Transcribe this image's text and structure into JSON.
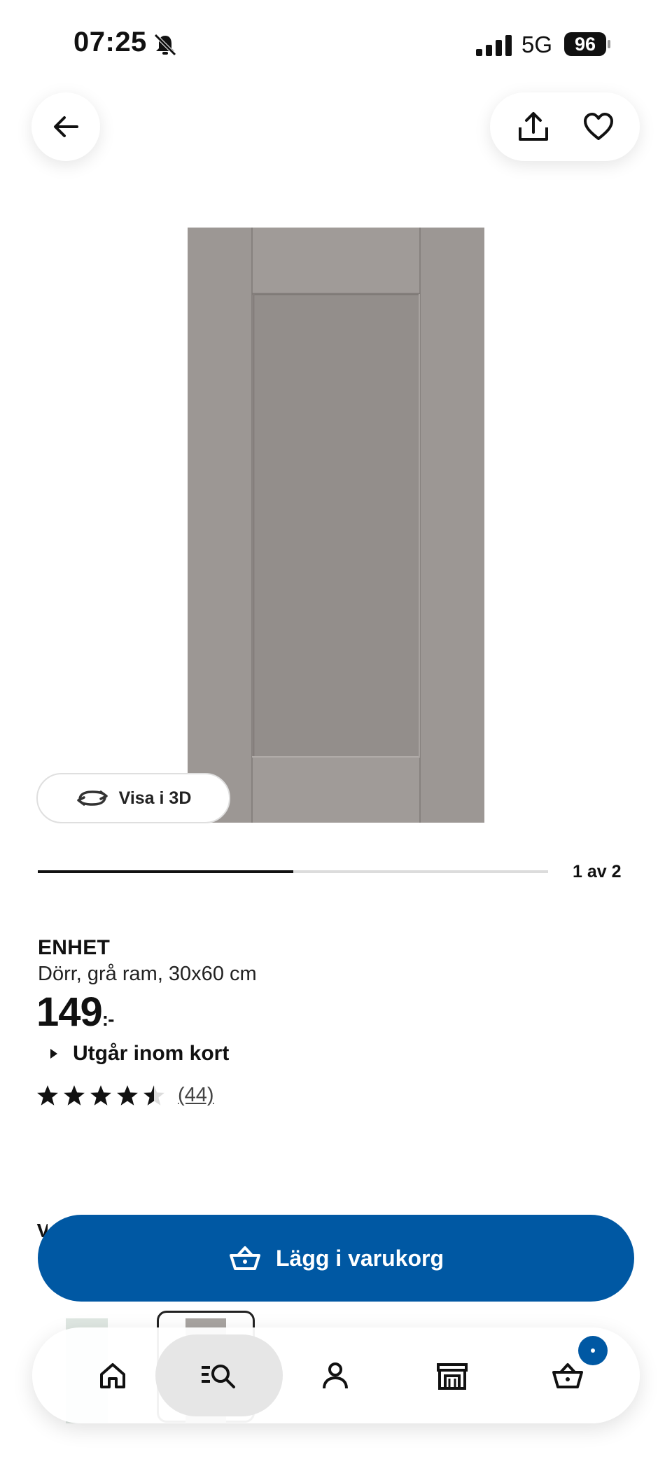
{
  "status_bar": {
    "time": "07:25",
    "network": "5G",
    "battery": "96"
  },
  "gallery": {
    "visa_3d_label": "Visa i 3D",
    "position_text": "1 av 2",
    "progress_fraction": 0.5
  },
  "product": {
    "brand": "ENHET",
    "description": "Dörr, grå ram, 30x60 cm",
    "price": "149",
    "price_suffix": ":-",
    "availability": "Utgår inom kort",
    "rating": 4.5,
    "review_count": "(44)",
    "partial_heading": "V"
  },
  "cart_button": {
    "label": "Lägg i varukorg"
  },
  "colors": {
    "ikea_blue": "#0058a3",
    "door_frame": "#9c9794",
    "door_panel": "#938e8b"
  },
  "icons": {
    "back": "arrow-left-icon",
    "share": "share-icon",
    "favorite": "heart-icon",
    "rotate": "rotate-3d-icon",
    "cart": "basket-icon",
    "nav": [
      "home-icon",
      "search-icon",
      "profile-icon",
      "store-icon",
      "basket-icon"
    ]
  }
}
